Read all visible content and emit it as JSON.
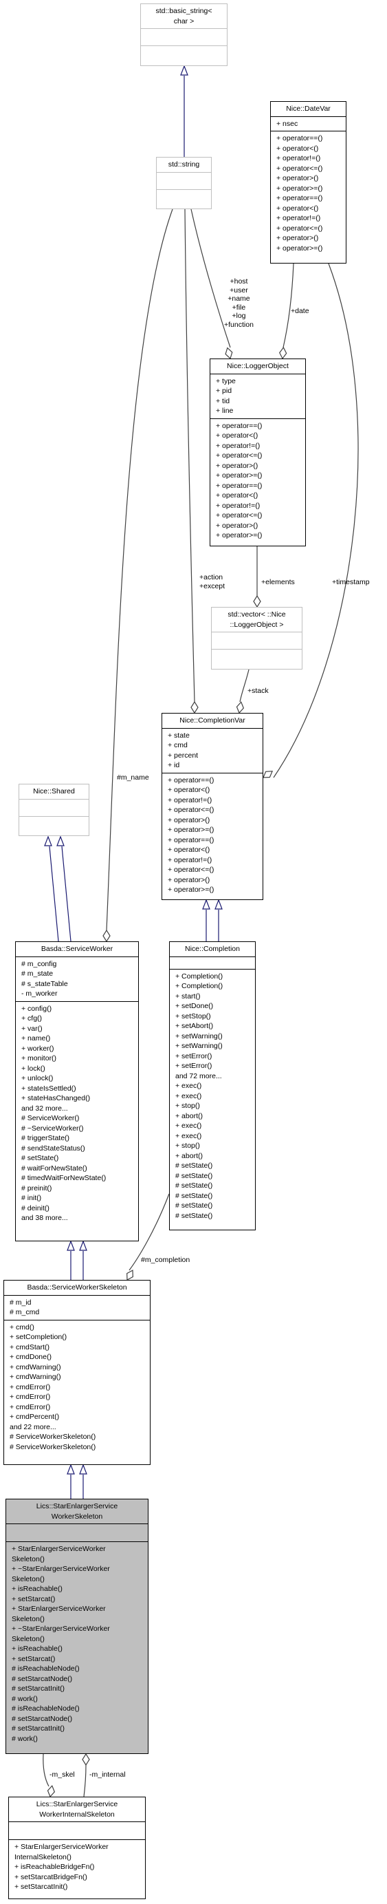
{
  "classes": {
    "basic_string": {
      "name": "std::basic_string<\nchar >",
      "attributes": [],
      "methods": []
    },
    "string": {
      "name": "std::string",
      "attributes": [],
      "methods": []
    },
    "datevar": {
      "name": "Nice::DateVar",
      "attributes": [
        "+ nsec"
      ],
      "methods": [
        "+ operator==()",
        "+ operator<()",
        "+ operator!=()",
        "+ operator<=()",
        "+ operator>()",
        "+ operator>=()",
        "+ operator==()",
        "+ operator<()",
        "+ operator!=()",
        "+ operator<=()",
        "+ operator>()",
        "+ operator>=()"
      ]
    },
    "loggerobject": {
      "name": "Nice::LoggerObject",
      "attributes": [
        "+ type",
        "+ pid",
        "+ tid",
        "+ line"
      ],
      "methods": [
        "+ operator==()",
        "+ operator<()",
        "+ operator!=()",
        "+ operator<=()",
        "+ operator>()",
        "+ operator>=()",
        "+ operator==()",
        "+ operator<()",
        "+ operator!=()",
        "+ operator<=()",
        "+ operator>()",
        "+ operator>=()"
      ]
    },
    "vector": {
      "name": "std::vector< ::Nice\n::LoggerObject >",
      "attributes": [],
      "methods": []
    },
    "completionvar": {
      "name": "Nice::CompletionVar",
      "attributes": [
        "+ state",
        "+ cmd",
        "+ percent",
        "+ id"
      ],
      "methods": [
        "+ operator==()",
        "+ operator<()",
        "+ operator!=()",
        "+ operator<=()",
        "+ operator>()",
        "+ operator>=()",
        "+ operator==()",
        "+ operator<()",
        "+ operator!=()",
        "+ operator<=()",
        "+ operator>()",
        "+ operator>=()"
      ]
    },
    "shared": {
      "name": "Nice::Shared",
      "attributes": [],
      "methods": []
    },
    "serviceworker": {
      "name": "Basda::ServiceWorker",
      "attributes": [
        "# m_config",
        "# m_state",
        "# s_stateTable",
        "- m_worker"
      ],
      "methods": [
        "+ config()",
        "+ cfg()",
        "+ var()",
        "+ name()",
        "+ worker()",
        "+ monitor()",
        "+ lock()",
        "+ unlock()",
        "+ stateIsSettled()",
        "+ stateHasChanged()",
        "and 32 more...",
        "# ServiceWorker()",
        "# ~ServiceWorker()",
        "# triggerState()",
        "# sendStateStatus()",
        "# setState()",
        "# waitForNewState()",
        "# timedWaitForNewState()",
        "# preinit()",
        "# init()",
        "# deinit()",
        "and 38 more..."
      ]
    },
    "completion": {
      "name": "Nice::Completion",
      "attributes": [],
      "methods": [
        "+ Completion()",
        "+ Completion()",
        "+ start()",
        "+ setDone()",
        "+ setStop()",
        "+ setAbort()",
        "+ setWarning()",
        "+ setWarning()",
        "+ setError()",
        "+ setError()",
        "and 72 more...",
        "+ exec()",
        "+ exec()",
        "+ stop()",
        "+ abort()",
        "+ exec()",
        "+ exec()",
        "+ stop()",
        "+ abort()",
        "# setState()",
        "# setState()",
        "# setState()",
        "# setState()",
        "# setState()",
        "# setState()"
      ]
    },
    "skeleton": {
      "name": "Basda::ServiceWorkerSkeleton",
      "attributes": [
        "# m_id",
        "# m_cmd"
      ],
      "methods": [
        "+ cmd()",
        "+ setCompletion()",
        "+ cmdStart()",
        "+ cmdDone()",
        "+ cmdWarning()",
        "+ cmdWarning()",
        "+ cmdError()",
        "+ cmdError()",
        "+ cmdError()",
        "+ cmdPercent()",
        "and 22 more...",
        "# ServiceWorkerSkeleton()",
        "# ServiceWorkerSkeleton()"
      ]
    },
    "starenlarger": {
      "name": "Lics::StarEnlargerService\nWorkerSkeleton",
      "attributes": [],
      "methods": [
        "+ StarEnlargerServiceWorker",
        "Skeleton()",
        "+ ~StarEnlargerServiceWorker",
        "Skeleton()",
        "+ isReachable()",
        "+ setStarcat()",
        "+ StarEnlargerServiceWorker",
        "Skeleton()",
        "+ ~StarEnlargerServiceWorker",
        "Skeleton()",
        "+ isReachable()",
        "+ setStarcat()",
        "# isReachableNode()",
        "# setStarcatNode()",
        "# setStarcatInit()",
        "# work()",
        "# isReachableNode()",
        "# setStarcatNode()",
        "# setStarcatInit()",
        "# work()"
      ]
    },
    "internal": {
      "name": "Lics::StarEnlargerService\nWorkerInternalSkeleton",
      "attributes": [],
      "methods": [
        "+ StarEnlargerServiceWorker",
        "InternalSkeleton()",
        "+ isReachableBridgeFn()",
        "+ setStarcatBridgeFn()",
        "+ setStarcatInit()"
      ]
    }
  },
  "edge_labels": {
    "string_to_logger": [
      "+host",
      "+user",
      "+name",
      "+file",
      "+log",
      "+function"
    ],
    "datevar_to_logger": "+date",
    "string_to_completionvar": [
      "+action",
      "+except"
    ],
    "logger_to_vector": "+elements",
    "datevar_to_completionvar": "+timestamp",
    "vector_to_completionvar": "+stack",
    "string_to_serviceworker": "#m_name",
    "completion_to_skeleton": "#m_completion",
    "internal_to_starenlarger": "-m_internal",
    "starenlarger_to_internal": "-m_skel"
  },
  "colors": {
    "inheritance": "#191970",
    "association": "#404040",
    "focus_fill": "#bfbfbf",
    "external_border": "#bfbfbf"
  }
}
